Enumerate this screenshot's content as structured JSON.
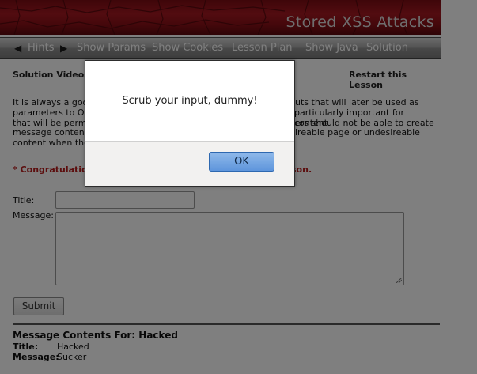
{
  "banner": {
    "title": "Stored XSS Attacks"
  },
  "nav": {
    "hints_label": "Hints",
    "items": [
      "Show Params",
      "Show Cookies",
      "Lesson Plan",
      "Show Java",
      "Solution"
    ]
  },
  "content": {
    "solution_videos": "Solution Videos",
    "restart": "Restart this Lesson",
    "para_lines": [
      "It is always a goo",
      "parameters to OS",
      "that will be perm",
      "message conten",
      "content when the"
    ],
    "para_right_lines": [
      "uts that will later be used as",
      "particularly important for content",
      "ers should not be able to create",
      "ireable page or undesireable"
    ],
    "congrats_left": "* Congratulatio",
    "congrats_right": "esson.",
    "title_label": "Title:",
    "message_label": "Message:",
    "submit_label": "Submit",
    "message_heading": "Message Contents For: Hacked",
    "detail_title_key": "Title:",
    "detail_title_val": "Hacked",
    "detail_message_key": "Message:",
    "detail_message_val": "Sucker"
  },
  "dialog": {
    "message": "Scrub your input, dummy!",
    "ok_label": "OK"
  },
  "colors": {
    "banner": "#a51821",
    "congrats": "#b81c1c",
    "ok_button": "#5e95dc"
  }
}
